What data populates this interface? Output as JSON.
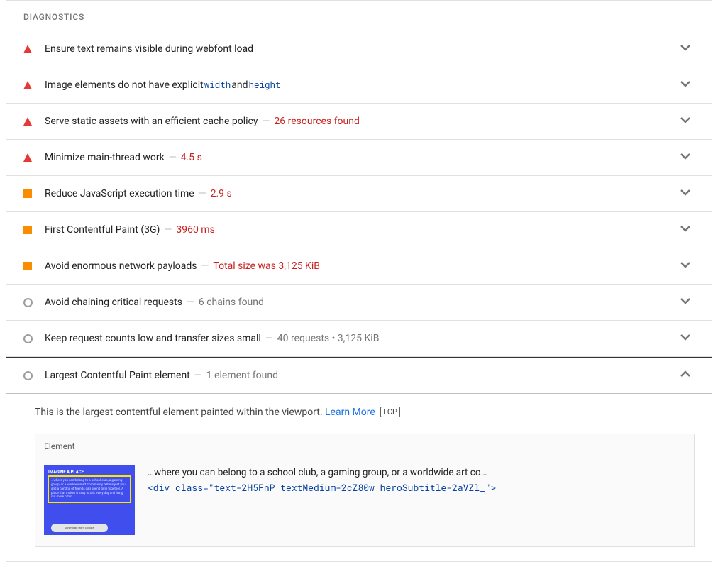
{
  "section_title": "DIAGNOSTICS",
  "items": [
    {
      "severity": "fail",
      "title": "Ensure text remains visible during webfont load",
      "detail": "",
      "detail_style": "none",
      "chev": "down"
    },
    {
      "severity": "fail",
      "title_html_parts": [
        "Image elements do not have explicit ",
        {
          "code": "width"
        },
        " and ",
        {
          "code": "height"
        }
      ],
      "detail": "",
      "detail_style": "none",
      "chev": "down"
    },
    {
      "severity": "fail",
      "title": "Serve static assets with an efficient cache policy",
      "detail": "26 resources found",
      "detail_style": "red",
      "chev": "down"
    },
    {
      "severity": "fail",
      "title": "Minimize main-thread work",
      "detail": "4.5 s",
      "detail_style": "red",
      "chev": "down"
    },
    {
      "severity": "avg",
      "title": "Reduce JavaScript execution time",
      "detail": "2.9 s",
      "detail_style": "red",
      "chev": "down"
    },
    {
      "severity": "avg",
      "title": "First Contentful Paint (3G)",
      "detail": "3960 ms",
      "detail_style": "red",
      "chev": "down"
    },
    {
      "severity": "avg",
      "title": "Avoid enormous network payloads",
      "detail": "Total size was 3,125 KiB",
      "detail_style": "red",
      "chev": "down"
    },
    {
      "severity": "info",
      "title": "Avoid chaining critical requests",
      "detail": "6 chains found",
      "detail_style": "grey",
      "chev": "down"
    },
    {
      "severity": "info",
      "title": "Keep request counts low and transfer sizes small",
      "detail": "40 requests • 3,125 KiB",
      "detail_style": "grey",
      "chev": "down"
    },
    {
      "severity": "info",
      "title": "Largest Contentful Paint element",
      "detail": "1 element found",
      "detail_style": "grey",
      "chev": "up",
      "expanded": true
    }
  ],
  "expanded": {
    "description": "This is the largest contentful element painted within the viewport. ",
    "learn_more": "Learn More",
    "badge": "LCP",
    "element_header": "Element",
    "thumb_heading": "IMAGINE A PLACE...",
    "thumb_text": "...where you can belong to a school club, a gaming group, or a worldwide art community. Where just you and a handful of friends can spend time together. A place that makes it easy to talk every day and hang out more often.",
    "thumb_button": "Download from Google",
    "snippet_text": "…where you can belong to a school club, a gaming group, or a worldwide art co…",
    "markup": "<div class=\"text-2H5FnP textMedium-2cZ80w heroSubtitle-2aVZl_\">"
  }
}
